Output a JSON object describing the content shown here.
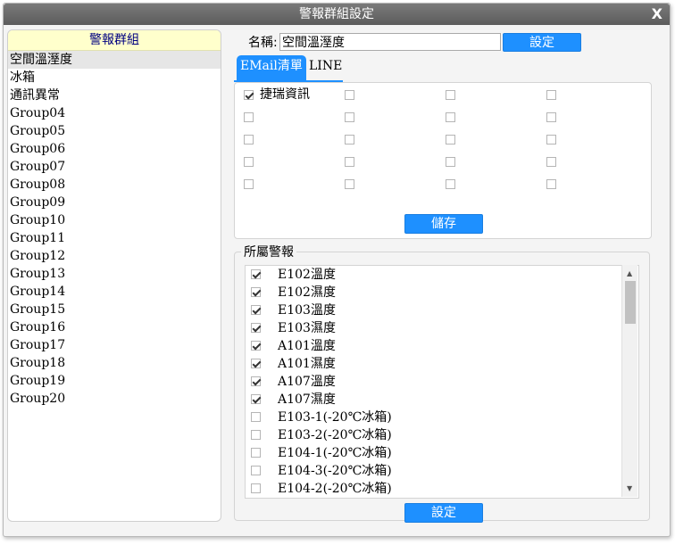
{
  "dialog": {
    "title": "警報群組設定",
    "close_label": "X"
  },
  "groups": {
    "header": "警報群組",
    "items": [
      "空間溫溼度",
      "冰箱",
      "通訊異常",
      "Group04",
      "Group05",
      "Group06",
      "Group07",
      "Group08",
      "Group09",
      "Group10",
      "Group11",
      "Group12",
      "Group13",
      "Group14",
      "Group15",
      "Group16",
      "Group17",
      "Group18",
      "Group19",
      "Group20"
    ],
    "selected_index": 0
  },
  "name": {
    "label": "名稱:",
    "value": "空間溫溼度",
    "set_button": "設定"
  },
  "tabs": [
    {
      "label": "EMail清單",
      "active": true
    },
    {
      "label": "LINE",
      "active": false
    }
  ],
  "email": {
    "first_label": "捷瑞資訊",
    "rows": 5,
    "cols": 4,
    "checked": [
      [
        true,
        false,
        false,
        false
      ],
      [
        false,
        false,
        false,
        false
      ],
      [
        false,
        false,
        false,
        false
      ],
      [
        false,
        false,
        false,
        false
      ],
      [
        false,
        false,
        false,
        false
      ]
    ],
    "save_button": "儲存"
  },
  "alarms": {
    "legend": "所屬警報",
    "items": [
      {
        "label": "E102溫度",
        "checked": true
      },
      {
        "label": "E102濕度",
        "checked": true
      },
      {
        "label": "E103溫度",
        "checked": true
      },
      {
        "label": "E103濕度",
        "checked": true
      },
      {
        "label": "A101溫度",
        "checked": true
      },
      {
        "label": "A101濕度",
        "checked": true
      },
      {
        "label": "A107溫度",
        "checked": true
      },
      {
        "label": "A107濕度",
        "checked": true
      },
      {
        "label": "E103-1(-20℃冰箱)",
        "checked": false
      },
      {
        "label": "E103-2(-20℃冰箱)",
        "checked": false
      },
      {
        "label": "E104-1(-20℃冰箱)",
        "checked": false
      },
      {
        "label": "E104-3(-20℃冰箱)",
        "checked": false
      },
      {
        "label": "E104-2(-20℃冰箱)",
        "checked": false
      }
    ],
    "set_button": "設定"
  },
  "colors": {
    "accent": "#1e90ff",
    "title_bar": "#666666",
    "group_header_bg": "#ffffcc",
    "group_header_text": "#000080"
  }
}
